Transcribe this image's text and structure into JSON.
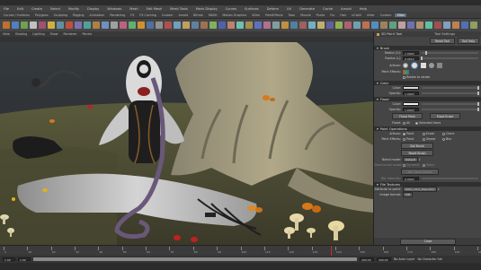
{
  "window": {
    "title": ""
  },
  "menubar": {
    "items": [
      "File",
      "Edit",
      "Create",
      "Select",
      "Modify",
      "Display",
      "Windows",
      "Mesh",
      "Edit Mesh",
      "Mesh Tools",
      "Mesh Display",
      "Curves",
      "Surfaces",
      "Deform",
      "UV",
      "Generate",
      "Cache",
      "Arnold",
      "Help"
    ]
  },
  "shelf": {
    "tabs": [
      "Curves / Surfaces",
      "Polygons",
      "Sculpting",
      "Rigging",
      "Animation",
      "Rendering",
      "FX",
      "FX Caching",
      "Custom",
      "Arnold",
      "Bifrost",
      "MASH",
      "Motion Graphics",
      "XGen",
      "PaintEffects",
      "Toon",
      "Muscle",
      "Fluids",
      "Fur",
      "Hair",
      "nCloth",
      "nHair",
      "Custom",
      "XGen"
    ],
    "active_index": 23
  },
  "viewport": {
    "menu": [
      "View",
      "Shading",
      "Lighting",
      "Show",
      "Renderer",
      "Panels"
    ],
    "scene": "stylized monkey character with a curled hose sitting before a large tree root, mushrooms and orange butterflies"
  },
  "attr_editor": {
    "title": "3D Paint Tool",
    "tabs": [
      "Tool Settings"
    ],
    "reset_label": "Reset Tool",
    "help_label": "Tool Help",
    "brush": {
      "header": "Brush",
      "radius_u_label": "Radius (U):",
      "radius_u": "1.0000",
      "radius_u_pos": 0.08,
      "radius_l_label": "Radius (L):",
      "radius_l": "0.0010",
      "radius_l_pos": 0.0,
      "artisan_label": "Artisan:",
      "paint_effects_label": "Paint Effects:",
      "rotate_to_stroke_label": "Rotate to stroke"
    },
    "color": {
      "header": "Color",
      "color_label": "Color:",
      "swatch_color": "#d9d9d9",
      "opacity_label": "Opacity:",
      "opacity": "1.0000",
      "opacity_pos": 1.0
    },
    "flood": {
      "header": "Flood",
      "color_label": "Color:",
      "color_pos": 1.0,
      "opacity_label": "Opacity:",
      "opacity": "1.0000",
      "opacity_pos": 1.0,
      "flood_paint_label": "Flood Paint",
      "flood_erase_label": "Flood Erase",
      "flood_label": "Flood:",
      "flood_option1": "All",
      "flood_option2": "Selected faces"
    },
    "paint_ops": {
      "header": "Paint Operations",
      "artisan_label": "Artisan:",
      "artisan_options": [
        "Paint",
        "Erase",
        "Clone"
      ],
      "pe_label": "Paint Effects:",
      "pe_options": [
        "Paint",
        "Smear",
        "Blur"
      ],
      "get_brush_label": "Get Brush",
      "reset_brush_label": "Reset Brush",
      "blend_mode_label": "Blend mode:",
      "blend_mode_value": "Default",
      "clone_brush_label": "Clone brush mode:",
      "clone_options": [
        "Dynamic",
        "Static"
      ],
      "set_clone_label": "Set Clone Source",
      "bg_intensity_label": "Bkr intensity:",
      "bg_intensity": "0.0000"
    },
    "file_textures": {
      "header": "File Textures",
      "attr_label": "Attribute to paint:",
      "attr_value": "blinn_color_tree.color",
      "image_format_label": "Image format:",
      "image_format_value": "Tiff"
    },
    "close_label": "Close"
  },
  "timeline": {
    "ticks": [
      "1",
      "10",
      "20",
      "30",
      "40",
      "50",
      "60",
      "70",
      "80",
      "90",
      "100",
      "110",
      "120",
      "130",
      "140",
      "150",
      "160",
      "170",
      "180",
      "190",
      "200"
    ],
    "current_frame": "1",
    "current_frame_pos": 0.69
  },
  "range": {
    "start": "1.00",
    "start2": "1.00",
    "end": "200.00",
    "end2": "200.00"
  },
  "statusbar": {
    "character_set": "No Character Set",
    "anim_layer": "No Anim Layer"
  },
  "colors": {
    "ui_dark": "#2b2b2b",
    "ui_mid": "#444444",
    "ui_panel": "#454545",
    "accent": "#5c6c7c",
    "timeline_marker": "#c03030",
    "sky": "#2b2e31"
  }
}
